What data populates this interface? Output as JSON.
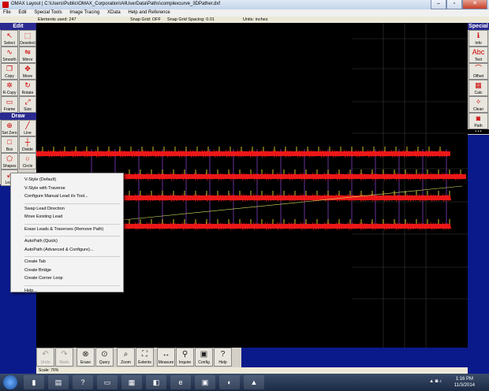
{
  "window": {
    "title": "OMAX Layout | C:\\Users\\Public\\OMAX_Corporation\\AllUserData\\Paths\\complexcurve_3DPather.dxf"
  },
  "menu": [
    "File",
    "Edit",
    "Special Tools",
    "Image Tracing",
    "XData",
    "Help and Reference"
  ],
  "info": {
    "elements": "Elements used: 247",
    "snap_grid": "Snap Grid: OFF",
    "snap_spacing": "Snap Grid Spacing: 0.01",
    "units": "Units: inches"
  },
  "left_panel": {
    "edit_header": "Edit",
    "edit_tools": [
      {
        "label": "Select",
        "icon": "select-arrow-icon",
        "glyph": "↖"
      },
      {
        "label": "Deselect",
        "icon": "deselect-icon",
        "glyph": "⬚"
      },
      {
        "label": "Smooth",
        "icon": "smooth-icon",
        "glyph": "∿"
      },
      {
        "label": "Mirror",
        "icon": "mirror-icon",
        "glyph": "⇋"
      },
      {
        "label": "Copy",
        "icon": "copy-icon",
        "glyph": "❐"
      },
      {
        "label": "Move",
        "icon": "move-icon",
        "glyph": "✥"
      },
      {
        "label": "R-Copy",
        "icon": "rotate-copy-icon",
        "glyph": "✲"
      },
      {
        "label": "Rotate",
        "icon": "rotate-icon",
        "glyph": "↻"
      },
      {
        "label": "Frame",
        "icon": "frame-icon",
        "glyph": "▭"
      },
      {
        "label": "Size",
        "icon": "size-icon",
        "glyph": "⤢"
      }
    ],
    "draw_header": "Draw",
    "draw_tools": [
      {
        "label": "Set Zero",
        "icon": "set-zero-icon",
        "glyph": "⊕"
      },
      {
        "label": "Line",
        "icon": "line-icon",
        "glyph": "╱"
      },
      {
        "label": "Box",
        "icon": "box-icon",
        "glyph": "□"
      },
      {
        "label": "Divide",
        "icon": "divide-icon",
        "glyph": "┼"
      },
      {
        "label": "Shapes",
        "icon": "shapes-icon",
        "glyph": "⬠"
      },
      {
        "label": "Circle",
        "icon": "circle-icon",
        "glyph": "○"
      },
      {
        "label": "Lead",
        "icon": "lead-icon",
        "glyph": "↙"
      }
    ]
  },
  "right_panel": {
    "header": "Special",
    "tools": [
      {
        "label": "Info",
        "icon": "info-icon",
        "glyph": "ℹ"
      },
      {
        "label": "Text",
        "icon": "text-icon",
        "glyph": "Abc"
      },
      {
        "label": "Offset",
        "icon": "offset-icon",
        "glyph": "⌒"
      },
      {
        "label": "Calc",
        "icon": "calculator-icon",
        "glyph": "▦"
      },
      {
        "label": "Clean",
        "icon": "clean-icon",
        "glyph": "✧"
      },
      {
        "label": "Path",
        "icon": "path-icon",
        "glyph": "◙"
      }
    ],
    "dots": "• • •"
  },
  "context_menu": {
    "groups": [
      [
        "V-Style (Default)",
        "V-Style with Traverse",
        "Configure Manual Lead i/o Tool..."
      ],
      [
        "Swap Lead Direction",
        "Move Existing Lead"
      ],
      [
        "Erase Leads & Traverses (Remove Path)"
      ],
      [
        "AutoPath (Quick)",
        "AutoPath (Advanced & Configure)..."
      ],
      [
        "Create Tab",
        "Create Bridge",
        "Create Corner Loop"
      ],
      [
        "Help..."
      ]
    ]
  },
  "bottom_tools": [
    {
      "label": "Undo",
      "icon": "undo-icon",
      "glyph": "↶",
      "enabled": false
    },
    {
      "label": "Redo",
      "icon": "redo-icon",
      "glyph": "↷",
      "enabled": false
    },
    {
      "label": "Erase",
      "icon": "erase-icon",
      "glyph": "⊗",
      "enabled": true
    },
    {
      "label": "Query",
      "icon": "query-icon",
      "glyph": "⊙",
      "enabled": true
    },
    {
      "label": "Zoom",
      "icon": "zoom-icon",
      "glyph": "⌕",
      "enabled": true
    },
    {
      "label": "Extents",
      "icon": "extents-icon",
      "glyph": "⛶",
      "enabled": true
    },
    {
      "label": "Measure",
      "icon": "measure-icon",
      "glyph": "↔",
      "enabled": true
    },
    {
      "label": "Inquire",
      "icon": "inquire-icon",
      "glyph": "⚲",
      "enabled": true
    },
    {
      "label": "Config",
      "icon": "config-icon",
      "glyph": "▣",
      "enabled": true
    },
    {
      "label": "Help",
      "icon": "help-icon",
      "glyph": "?",
      "enabled": true
    }
  ],
  "status": {
    "scale": "Scale: 76%"
  },
  "taskbar": {
    "apps": [
      "▮",
      "▤",
      "?",
      "▭",
      "▦",
      "◧",
      "e",
      "▣",
      "◐",
      "▲"
    ],
    "time": "1:16 PM",
    "date": "11/3/2014"
  },
  "colors": {
    "toolpath": "#ff1a1a",
    "lead_marks": "#ffee33",
    "frame_lines": "#b050ff",
    "grid": "#3a3a3a",
    "traverse": "#d8e060"
  }
}
